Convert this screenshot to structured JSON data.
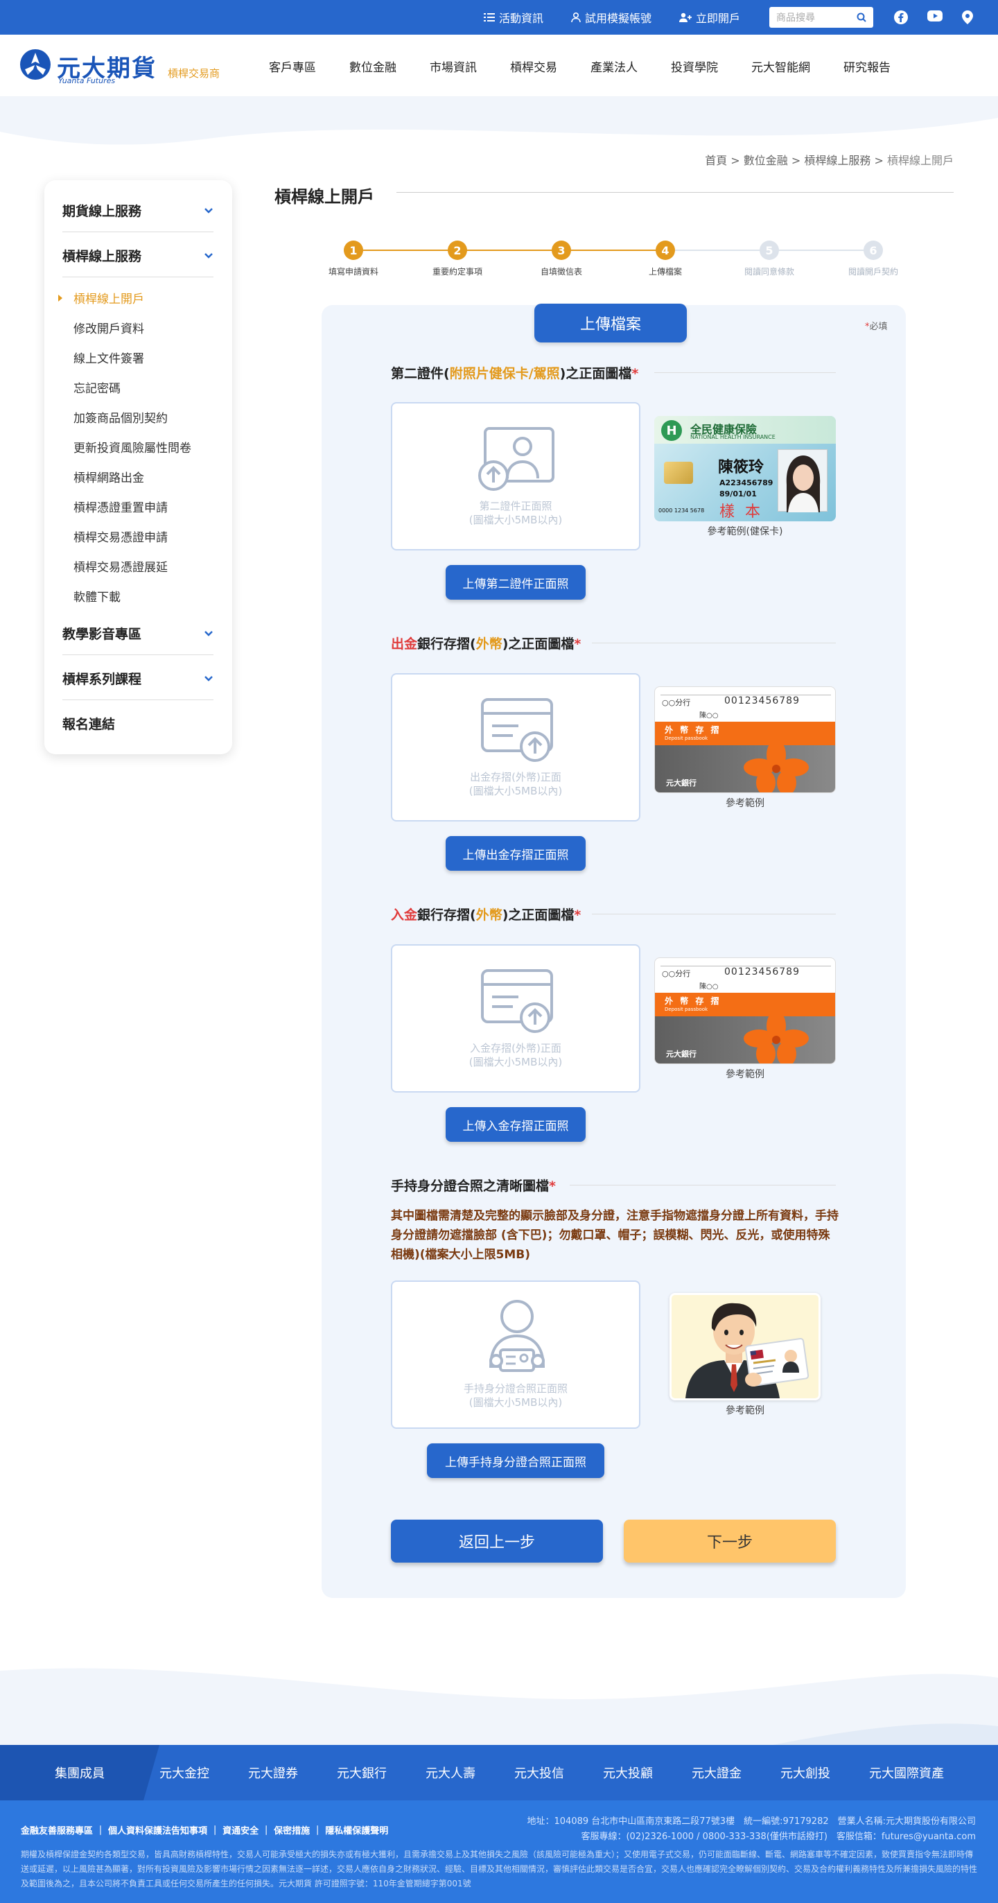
{
  "topbar": {
    "links": [
      "活動資訊",
      "試用模擬帳號",
      "立即開戶"
    ],
    "search_placeholder": "商品搜尋",
    "social": [
      "facebook-icon",
      "youtube-icon",
      "location-icon"
    ]
  },
  "header": {
    "brand": "元大期貨",
    "brand_en": "Yuanta Futures",
    "sub_brand": "槓桿交易商",
    "nav": [
      "客戶專區",
      "數位金融",
      "市場資訊",
      "槓桿交易",
      "產業法人",
      "投資學院",
      "元大智能網",
      "研究報告"
    ]
  },
  "breadcrumb": [
    "首頁",
    "數位金融",
    "槓桿線上服務",
    "槓桿線上開戶"
  ],
  "sidebar": {
    "sections": [
      "期貨線上服務",
      "槓桿線上服務",
      "教學影音專區",
      "槓桿系列課程",
      "報名連結"
    ],
    "items": [
      "槓桿線上開戶",
      "修改開戶資料",
      "線上文件簽署",
      "忘記密碼",
      "加簽商品個別契約",
      "更新投資風險屬性問卷",
      "槓桿網路出金",
      "槓桿憑證重置申請",
      "槓桿交易憑證申請",
      "槓桿交易憑證展延",
      "軟體下載"
    ]
  },
  "page_title": "槓桿線上開戶",
  "steps": [
    {
      "num": "1",
      "label": "填寫申請資料",
      "done": true
    },
    {
      "num": "2",
      "label": "重要約定事項",
      "done": true
    },
    {
      "num": "3",
      "label": "自填徵信表",
      "done": true
    },
    {
      "num": "4",
      "label": "上傳檔案",
      "done": true
    },
    {
      "num": "5",
      "label": "閱讀同意條款",
      "done": false
    },
    {
      "num": "6",
      "label": "閱讀開戶契約",
      "done": false
    }
  ],
  "card": {
    "tab": "上傳檔案",
    "required_mark": "*",
    "required_label": "必填"
  },
  "sections": [
    {
      "title_parts": [
        "第二證件(",
        "附照片健保卡/駕照",
        ")之正面圖檔"
      ],
      "upload_hint": [
        "第二證件正面照",
        "(圖檔大小5MB以內)"
      ],
      "button": "上傳第二證件正面照",
      "ref_caption": "參考範例(健保卡)"
    },
    {
      "title_parts": [
        "出金",
        "銀行存摺(",
        "外幣",
        ")之正面圖檔"
      ],
      "upload_hint": [
        "出金存摺(外幣)正面",
        "(圖檔大小5MB以內)"
      ],
      "button": "上傳出金存摺正面照",
      "ref_caption": "參考範例"
    },
    {
      "title_parts": [
        "入金",
        "銀行存摺(",
        "外幣",
        ")之正面圖檔"
      ],
      "upload_hint": [
        "入金存摺(外幣)正面",
        "(圖檔大小5MB以內)"
      ],
      "button": "上傳入金存摺正面照",
      "ref_caption": "參考範例"
    },
    {
      "title_parts": [
        "手持身分證合照之清晰圖檔"
      ],
      "note": "其中圖檔需清楚及完整的顯示臉部及身分證，注意手指物遮擋身分證上所有資料，手持身分證請勿遮擋臉部 (含下巴)；勿戴口罩、帽子；誤模糊、閃光、反光，或使用特殊相機)(檔案大小上限5MB)",
      "upload_hint": [
        "手持身分證合照正面照",
        "(圖檔大小5MB以內)"
      ],
      "button": "上傳手持身分證合照正面照",
      "ref_caption": "參考範例"
    }
  ],
  "health_card": {
    "header": "全民健康保險",
    "header_en": "NATIONAL HEALTH INSURANCE",
    "name": "陳筱玲",
    "id": "A223456789",
    "dob": "89/01/01",
    "sample": "樣 本",
    "cardno": "0000 1234 5678"
  },
  "passbook": {
    "account": "00123456789",
    "branch": "○○分行",
    "holder": "陳○○",
    "title": "外 幣 存 摺",
    "title_en": "Deposit passbook",
    "bank": "元大銀行"
  },
  "actions": {
    "back": "返回上一步",
    "next": "下一步"
  },
  "footer": {
    "group_label": "集團成員",
    "members": [
      "元大金控",
      "元大證券",
      "元大銀行",
      "元大人壽",
      "元大投信",
      "元大投顧",
      "元大證金",
      "元大創投",
      "元大國際資產"
    ],
    "links": "金融友善服務專區 ｜ 個人資料保護法告知事項 ｜ 資通安全 ｜ 保密措施 ｜ 隱私權保護聲明",
    "address": "地址：104089 台北市中山區南京東路二段77號3樓　統一編號:97179282　營業人名稱:元大期貨股份有限公司",
    "contact": "客服專線：(02)2326-1000 / 0800-333-338(僅供市話撥打)　客服信箱：futures@yuanta.com",
    "disclaimer": "期權及槓桿保證金契約各類型交易，皆具高財務槓桿特性，交易人可能承受極大的損失亦或有極大獲利，且需承擔交易上及其他損失之風險（該風險可能極為重大）；又使用電子式交易，仍可能面臨斷線、斷電、網路塞車等不確定因素，致使買賣指令無法即時傳送或延遲，以上風險甚為顯著，對所有投資風險及影響市場行情之因素無法逐一詳述，交易人應依自身之財務狀況、經驗、目標及其他相關情況，審慎評估此類交易是否合宜，交易人也應確認完全瞭解個別契約、交易及合約權利義務特性及所兼擔損失風險的特性及範圍後為之，且本公司將不負責工具或任何交易所產生的任何損失。元大期貨 許可證照字號：110年金管期總字第001號"
  },
  "colors": {
    "primary": "#2767cc",
    "accent": "#e39a1d",
    "next_button": "#ffc56a"
  }
}
